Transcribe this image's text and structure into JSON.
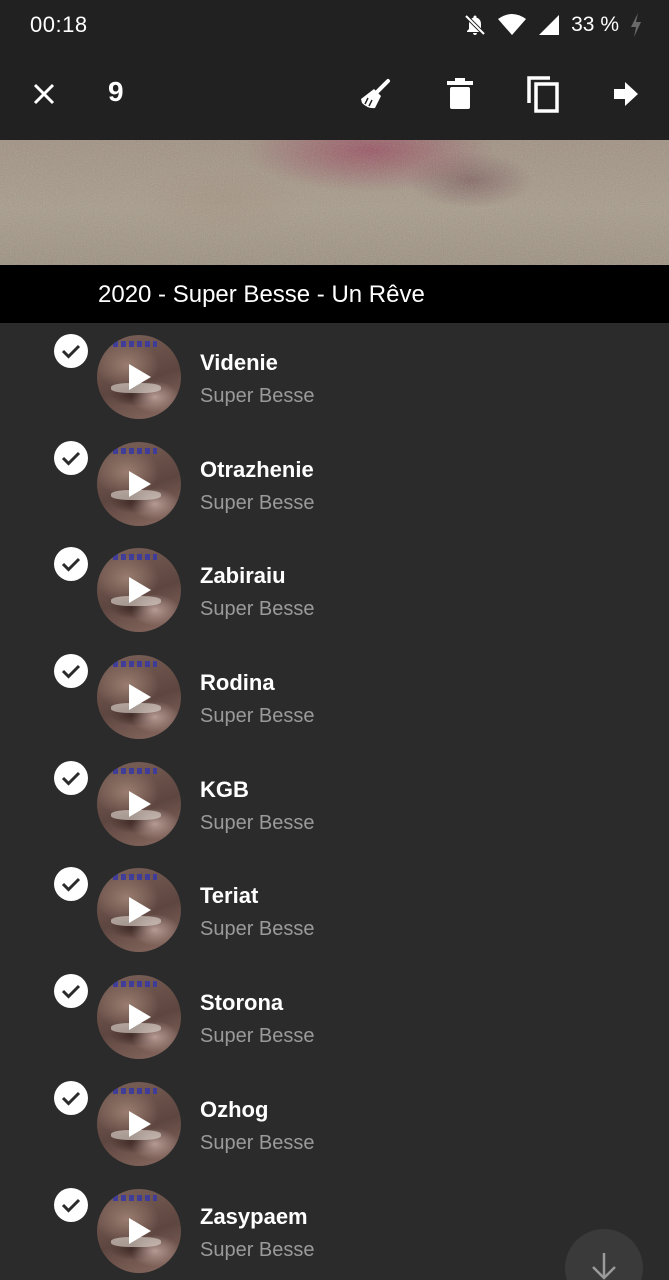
{
  "status_bar": {
    "time": "00:18",
    "battery": "33 %"
  },
  "toolbar": {
    "selected_count": "9",
    "icons": [
      "close-icon",
      "broom-icon",
      "trash-icon",
      "copy-icon",
      "arrow-right-icon"
    ]
  },
  "album": {
    "title": "2020 - Super Besse - Un Rêve"
  },
  "tracks": [
    {
      "title": "Videnie",
      "artist": "Super Besse",
      "selected": true
    },
    {
      "title": "Otrazhenie",
      "artist": "Super Besse",
      "selected": true
    },
    {
      "title": "Zabiraiu",
      "artist": "Super Besse",
      "selected": true
    },
    {
      "title": "Rodina",
      "artist": "Super Besse",
      "selected": true
    },
    {
      "title": "KGB",
      "artist": "Super Besse",
      "selected": true
    },
    {
      "title": "Teriat",
      "artist": "Super Besse",
      "selected": true
    },
    {
      "title": "Storona",
      "artist": "Super Besse",
      "selected": true
    },
    {
      "title": "Ozhog",
      "artist": "Super Besse",
      "selected": true
    },
    {
      "title": "Zasypaem",
      "artist": "Super Besse",
      "selected": true
    }
  ],
  "colors": {
    "background": "#2b2b2b",
    "toolbar": "#212121",
    "album_bar": "#000000",
    "artist_text": "#9a9a9a"
  }
}
